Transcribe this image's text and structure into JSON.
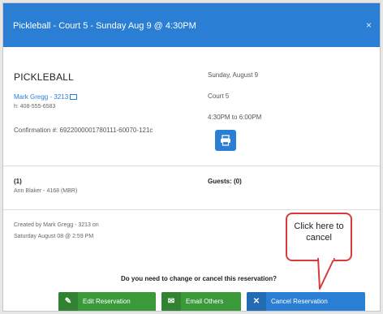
{
  "dialog": {
    "title": "Pickleball - Court 5 - Sunday Aug 9 @ 4:30PM",
    "close_icon": "×"
  },
  "reservation": {
    "name": "PICKLEBALL",
    "owner_link": "Mark Gregg - 3213",
    "phone": "h: 408-555-6583",
    "confirmation": "Confirmation #: 6922000001780111-60070-121c",
    "date": "Sunday, August 9",
    "court": "Court 5",
    "time": "4:30PM to 6:00PM"
  },
  "participants": {
    "count_label": "(1)",
    "member": "Ann Blaker - 4168 (MBR)",
    "guests_label": "Guests: (0)"
  },
  "created": {
    "line1": "Created by Mark Gregg - 3213 on",
    "line2": "Saturday August 08 @ 2:59 PM"
  },
  "prompt": "Do you need to change or cancel this reservation?",
  "buttons": {
    "edit": "Edit Reservation",
    "email": "Email Others",
    "cancel": "Cancel Reservation"
  },
  "callout": {
    "line1": "Click here to",
    "line2": "cancel"
  },
  "colors": {
    "primary": "#2a7fd4",
    "success": "#3a9a3a",
    "callout_border": "#d83a3a"
  }
}
